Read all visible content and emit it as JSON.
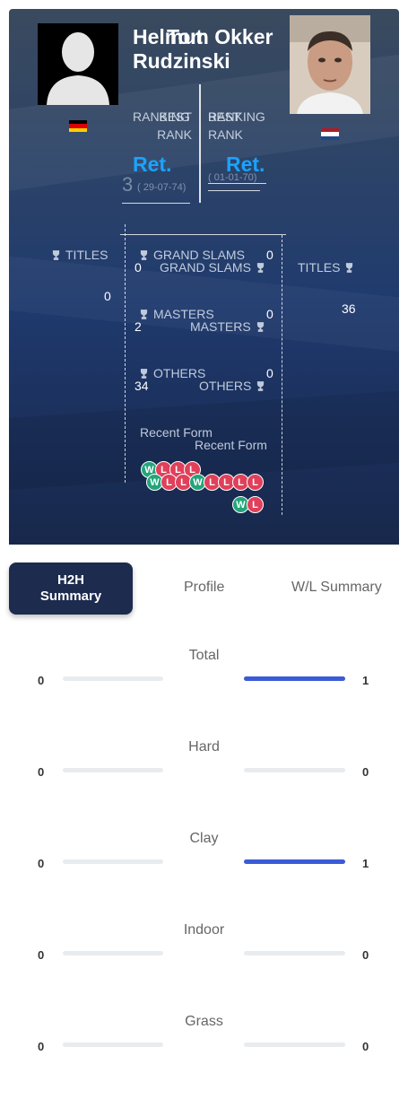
{
  "player1": {
    "name_line1": "Helmut",
    "name_line2": "Rudzinski",
    "flag": "germany-flag",
    "ranking_label": "RANKING",
    "best_rank_label": "BEST RANK",
    "ranking_value": "Ret.",
    "best_rank_value": "3",
    "best_rank_date": "( 29-07-74)",
    "titles_label": "TITLES",
    "titles": "0",
    "grand_slams": "0",
    "masters": "2",
    "others": "34",
    "recent_form": [
      "W",
      "L",
      "L",
      "L"
    ]
  },
  "player2": {
    "name_line1": "Tom Okker",
    "flag": "netherlands-flag",
    "ranking_label": "RANKING",
    "best_rank_label": "BEST RANK",
    "ranking_value": "Ret.",
    "best_rank_date": "( 01-01-70)",
    "titles_label": "TITLES",
    "titles": "36",
    "grand_slams": "0",
    "masters": "0",
    "others": "0",
    "recent_form_row1": [
      "W",
      "L",
      "L",
      "W",
      "L",
      "L",
      "L",
      "L"
    ],
    "recent_form_row2": [
      "W",
      "L"
    ]
  },
  "labels": {
    "grand_slams": "GRAND SLAMS",
    "masters": "MASTERS",
    "others": "OTHERS",
    "recent_form": "Recent Form"
  },
  "tabs": {
    "h2h": "H2H Summary",
    "profile": "Profile",
    "wl": "W/L Summary"
  },
  "stats": [
    {
      "label": "Total",
      "left": 0,
      "right": 1,
      "left_frac": 0,
      "right_frac": 1
    },
    {
      "label": "Hard",
      "left": 0,
      "right": 0,
      "left_frac": 0,
      "right_frac": 0
    },
    {
      "label": "Clay",
      "left": 0,
      "right": 1,
      "left_frac": 0,
      "right_frac": 1
    },
    {
      "label": "Indoor",
      "left": 0,
      "right": 0,
      "left_frac": 0,
      "right_frac": 0
    },
    {
      "label": "Grass",
      "left": 0,
      "right": 0,
      "left_frac": 0,
      "right_frac": 0
    }
  ],
  "colors": {
    "win": "#23a57a",
    "loss": "#e0405a",
    "accent": "#3b5bd6",
    "ret": "#1aa3ff",
    "tab_active": "#1d2b4f"
  }
}
